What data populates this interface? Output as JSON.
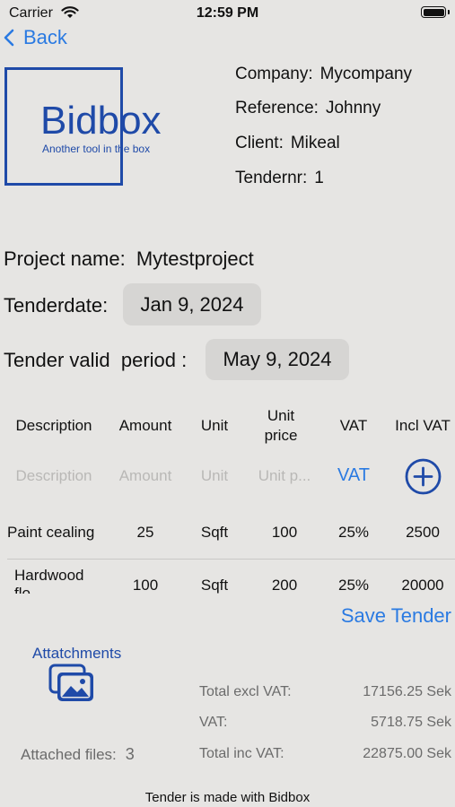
{
  "status": {
    "carrier": "Carrier",
    "time": "12:59 PM"
  },
  "nav": {
    "back_label": "Back"
  },
  "logo": {
    "name": "Bidbox",
    "tagline": "Another tool in the box"
  },
  "info": {
    "company_key": "Company:",
    "company_val": "Mycompany",
    "reference_key": "Reference:",
    "reference_val": "Johnny",
    "client_key": "Client:",
    "client_val": "Mikeal",
    "tendernr_key": "Tendernr:",
    "tendernr_val": "1"
  },
  "project": {
    "label": "Project name:",
    "value": "Mytestproject"
  },
  "tenderdate": {
    "label": "Tenderdate:",
    "value": "Jan 9, 2024"
  },
  "valid": {
    "label": "Tender valid  period :",
    "value": "May 9, 2024"
  },
  "table": {
    "headers": {
      "description": "Description",
      "amount": "Amount",
      "unit": "Unit",
      "unit_price_1": "Unit",
      "unit_price_2": "price",
      "vat": "VAT",
      "incl_vat": "Incl VAT"
    },
    "placeholders": {
      "description": "Description",
      "amount": "Amount",
      "unit": "Unit",
      "unit_price": "Unit p...",
      "vat": "VAT"
    },
    "rows": [
      {
        "description": "Paint cealing",
        "amount": "25",
        "unit": "Sqft",
        "unit_price": "100",
        "vat": "25%",
        "incl_vat": "2500"
      },
      {
        "description": "Hardwood",
        "description_2": "flo...",
        "amount": "100",
        "unit": "Sqft",
        "unit_price": "200",
        "vat": "25%",
        "incl_vat": "20000"
      }
    ]
  },
  "save_label": "Save Tender",
  "attachments": {
    "label": "Attatchments",
    "files_label": "Attached files:",
    "files_count": "3"
  },
  "totals": {
    "excl_key": "Total excl VAT:",
    "excl_val": "17156.25 Sek",
    "vat_key": "VAT:",
    "vat_val": "5718.75 Sek",
    "incl_key": "Total inc VAT:",
    "incl_val": "22875.00 Sek"
  },
  "footer": "Tender is made with Bidbox",
  "colors": {
    "accent": "#2a7ae2",
    "brand": "#1f4aa8",
    "background": "#e6e5e3"
  }
}
